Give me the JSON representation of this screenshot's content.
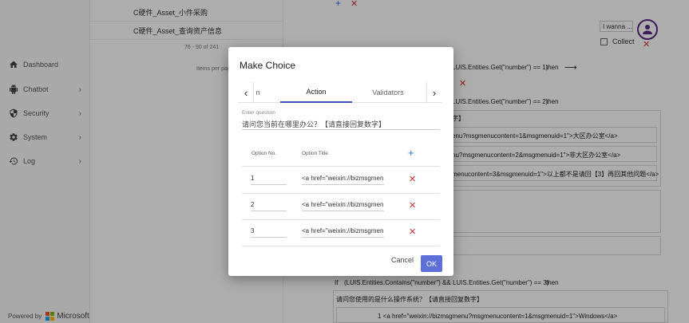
{
  "sidebar": {
    "items": [
      {
        "label": "Dashboard",
        "icon": "home-icon",
        "has_chevron": false
      },
      {
        "label": "Chatbot",
        "icon": "android-icon",
        "has_chevron": true
      },
      {
        "label": "Security",
        "icon": "shield-icon",
        "has_chevron": true
      },
      {
        "label": "System",
        "icon": "gear-icon",
        "has_chevron": true
      },
      {
        "label": "Log",
        "icon": "history-icon",
        "has_chevron": true
      }
    ],
    "powered_by": "Powered by",
    "brand": "Microsoft"
  },
  "asset_list": {
    "rows": [
      "C硬件_Asset_小件采购",
      "C硬件_Asset_查询资产信息"
    ],
    "pager": "76 - 90 of 241",
    "per_page": "Items per page"
  },
  "background": {
    "wanna_input": "I wanna ...",
    "collect_label": "Collect",
    "cond_1": "LUIS.Entities.Get(\"number\") == 1)",
    "then_1": "then",
    "cond_2": "LUIS.Entities.Get(\"number\") == 2)",
    "then_2": "then",
    "snip_bracket": "字】",
    "link_1": "enu?msgmenucontent=1&msgmenuid=1\">大区办公室</a>",
    "link_2": "nu?msgmenucontent=2&msgmenuid=1\">非大区办公室</a>",
    "link_3": "menucontent=3&msgmenuid=1\">以上都不是请回【3】再回其他问题</a>",
    "if_label": "If",
    "cond_3": "(LUIS.Entities.Contains(\"number\") && LUIS.Entities.Get(\"number\") == 3)",
    "then_3": "then",
    "question_3": "请问您使用的是什么操作系统？【请直接回复数字】",
    "link_4": "1 <a href=\"weixin://bizmsgmenu?msgmenucontent=1&msgmenuid=1\">Windows</a>"
  },
  "dialog": {
    "title": "Make Choice",
    "tab_partial": "n",
    "tabs": [
      "Action",
      "Validators"
    ],
    "question_label": "Enter question",
    "question_value": "请问您当前在哪里办公？【请直接回复数字】",
    "columns": [
      "Option No.",
      "Option Title"
    ],
    "options": [
      {
        "no": "1",
        "title": "<a href=\"weixin://bizmsgmenu"
      },
      {
        "no": "2",
        "title": "<a href=\"weixin://bizmsgmenu"
      },
      {
        "no": "3",
        "title": "<a href=\"weixin://bizmsgmenu"
      }
    ],
    "cancel_label": "Cancel",
    "ok_label": "OK"
  },
  "colors": {
    "accent": "#5f6fd8",
    "danger": "#d32f2f",
    "link_blue": "#1e6fd9",
    "avatar": "#5b2a86"
  }
}
